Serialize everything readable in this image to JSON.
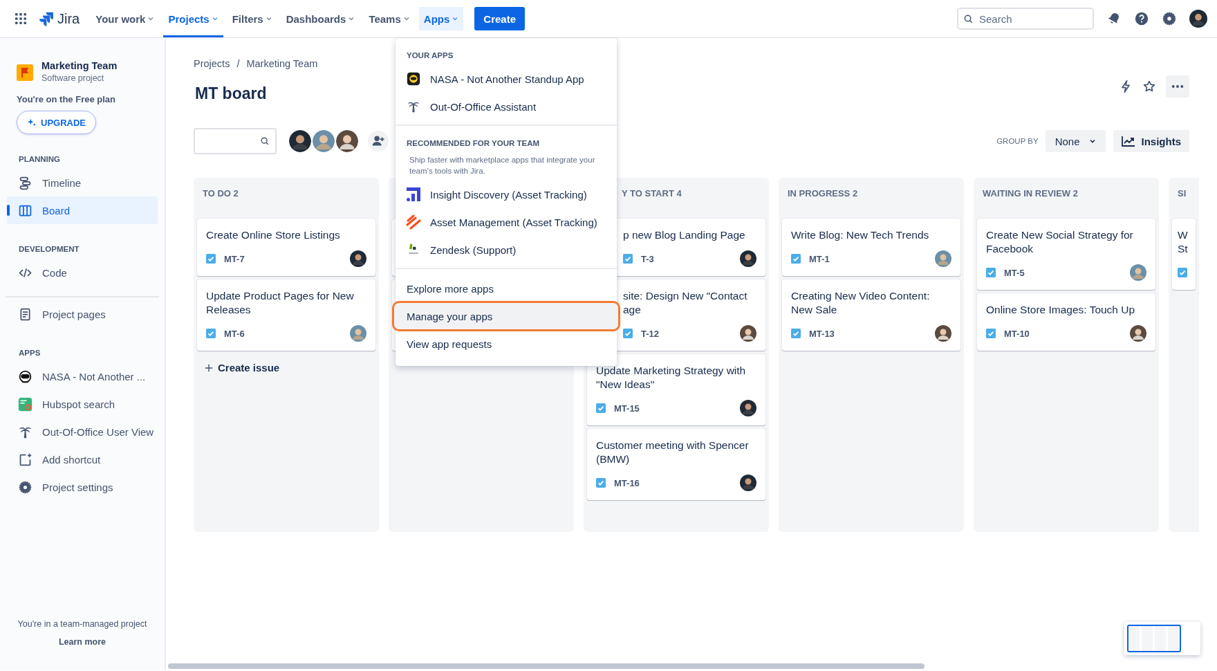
{
  "topbar": {
    "product": "Jira",
    "nav": [
      {
        "label": "Your work",
        "selected": false,
        "expanded": false
      },
      {
        "label": "Projects",
        "selected": true,
        "expanded": false
      },
      {
        "label": "Filters",
        "selected": false,
        "expanded": false
      },
      {
        "label": "Dashboards",
        "selected": false,
        "expanded": false
      },
      {
        "label": "Teams",
        "selected": false,
        "expanded": false
      },
      {
        "label": "Apps",
        "selected": false,
        "expanded": true
      }
    ],
    "create": "Create",
    "search": {
      "placeholder": "Search"
    }
  },
  "sidebar": {
    "project": {
      "name": "Marketing Team",
      "type": "Software project"
    },
    "plan_note": "You're on the Free plan",
    "upgrade": "UPGRADE",
    "sections": [
      {
        "heading": "PLANNING",
        "items": [
          {
            "label": "Timeline",
            "selected": false
          },
          {
            "label": "Board",
            "selected": true
          }
        ]
      },
      {
        "heading": "DEVELOPMENT",
        "items": [
          {
            "label": "Code",
            "selected": false
          }
        ]
      },
      {
        "divider_above": true,
        "items": [
          {
            "label": "Project pages",
            "selected": false
          }
        ]
      },
      {
        "heading": "APPS",
        "items": [
          {
            "label": "NASA - Not Another ...",
            "selected": false
          },
          {
            "label": "Hubspot search",
            "selected": false
          },
          {
            "label": "Out-Of-Office User View",
            "selected": false
          },
          {
            "label": "Add shortcut",
            "selected": false
          },
          {
            "label": "Project settings",
            "selected": false
          }
        ]
      }
    ],
    "footer": {
      "note": "You're in a team-managed project",
      "link": "Learn more"
    }
  },
  "main": {
    "breadcrumbs": [
      "Projects",
      "Marketing Team"
    ],
    "breadcrumb_separator": "/",
    "title": "MT board",
    "group_by": {
      "label": "GROUP BY",
      "value": "None"
    },
    "insights": "Insights",
    "columns": [
      {
        "kind": "full",
        "title": "TO DO 2",
        "cards": [
          {
            "kind": "task",
            "title": "Create Online Store Listings",
            "id": "MT-7"
          },
          {
            "kind": "task",
            "title": "Update Product Pages for New Releases",
            "id": "MT-6"
          }
        ],
        "create_issue": "Create issue"
      },
      {
        "kind": "full",
        "cards": [
          {
            "kind": "blank"
          },
          {
            "kind": "blank"
          }
        ]
      },
      {
        "kind": "left-covered",
        "title": "Y TO START 4",
        "cards": [
          {
            "kind": "left-covered",
            "title": "p new Blog Landing Page",
            "id": "T-3"
          },
          {
            "kind": "left-covered",
            "title": "site: Design New \"Contact age",
            "id": "T-12"
          },
          {
            "kind": "task",
            "title": "Update Marketing Strategy with \"New Ideas\"",
            "id": "MT-15"
          },
          {
            "kind": "task",
            "title": "Customer meeting with Spencer (BMW)",
            "id": "MT-16"
          }
        ]
      },
      {
        "kind": "full",
        "title": "IN PROGRESS 2",
        "cards": [
          {
            "kind": "task",
            "title": "Write Blog: New Tech Trends",
            "id": "MT-1"
          },
          {
            "kind": "task",
            "title": "Creating New Video Content: New Sale",
            "id": "MT-13"
          }
        ]
      },
      {
        "kind": "full",
        "title": "WAITING IN REVIEW 2",
        "cards": [
          {
            "kind": "task",
            "title": "Create New Social Strategy for Facebook",
            "id": "MT-5"
          },
          {
            "kind": "task",
            "title": "Online Store Images: Touch Up",
            "id": "MT-10"
          }
        ]
      },
      {
        "kind": "right-cut",
        "title": "SI",
        "cards": [
          {
            "kind": "task",
            "title": "W St"
          }
        ]
      }
    ]
  },
  "apps_menu": {
    "sections": [
      {
        "heading": "YOUR APPS",
        "items": [
          {
            "label": "NASA - Not Another Standup App",
            "selected": false,
            "highlighted": false
          },
          {
            "label": "Out-Of-Office Assistant",
            "selected": false,
            "highlighted": false
          }
        ]
      },
      {
        "heading": "RECOMMENDED FOR YOUR TEAM",
        "note": "Ship faster with marketplace apps that integrate your team’s tools with Jira.",
        "items": [
          {
            "label": "Insight Discovery (Asset Tracking)",
            "selected": false,
            "highlighted": false
          },
          {
            "label": "Asset Management (Asset Tracking)",
            "selected": false,
            "highlighted": false
          },
          {
            "label": "Zendesk (Support)",
            "selected": false,
            "highlighted": false
          }
        ]
      },
      {
        "items": [
          {
            "label": "Explore more apps",
            "selected": false,
            "highlighted": false
          },
          {
            "label": "Manage your apps",
            "selected": true,
            "highlighted": true
          },
          {
            "label": "View app requests",
            "selected": false,
            "highlighted": false
          }
        ]
      }
    ]
  }
}
